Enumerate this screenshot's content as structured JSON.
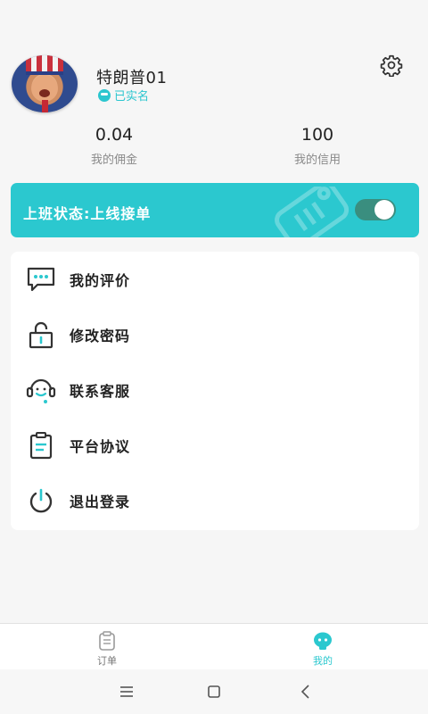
{
  "profile": {
    "username": "特朗普01",
    "verified_label": "已实名",
    "avatar": "avatar-portrait",
    "settings_icon": "gear-icon"
  },
  "stats": {
    "commission": {
      "value": "0.04",
      "label": "我的佣金"
    },
    "credit": {
      "value": "100",
      "label": "我的信用"
    }
  },
  "work_status": {
    "label": "上班状态:上线接单",
    "toggle_on": true,
    "accent_color": "#2bc8cf"
  },
  "menu": {
    "items": [
      {
        "label": "我的评价",
        "icon": "chat-bubble-icon"
      },
      {
        "label": "修改密码",
        "icon": "unlock-icon"
      },
      {
        "label": "联系客服",
        "icon": "headset-icon"
      },
      {
        "label": "平台协议",
        "icon": "clipboard-icon"
      },
      {
        "label": "退出登录",
        "icon": "power-icon"
      }
    ]
  },
  "tabbar": {
    "orders_label": "订单",
    "mine_label": "我的",
    "active": "我的"
  },
  "system_nav": {
    "buttons": [
      "menu-icon",
      "home-icon",
      "back-icon"
    ]
  }
}
